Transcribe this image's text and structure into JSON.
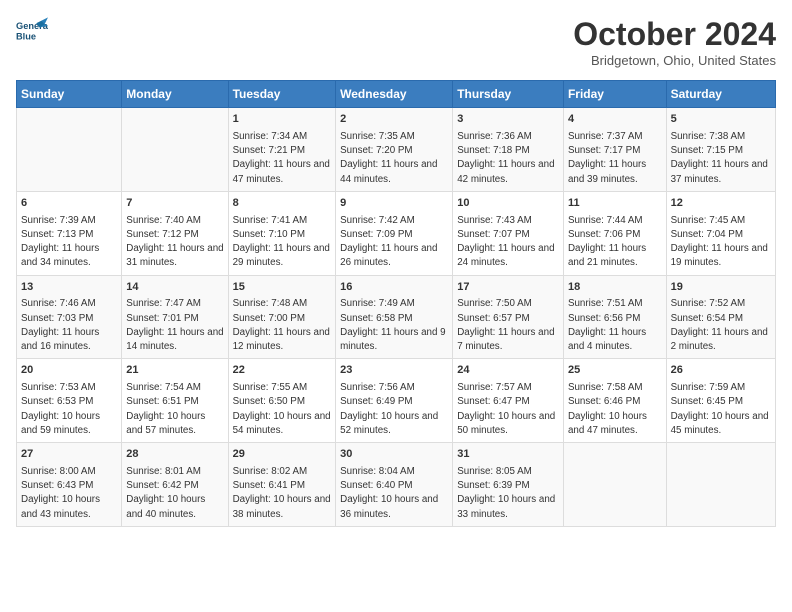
{
  "header": {
    "logo_line1": "General",
    "logo_line2": "Blue",
    "month_title": "October 2024",
    "location": "Bridgetown, Ohio, United States"
  },
  "columns": [
    "Sunday",
    "Monday",
    "Tuesday",
    "Wednesday",
    "Thursday",
    "Friday",
    "Saturday"
  ],
  "rows": [
    [
      {
        "day": "",
        "info": ""
      },
      {
        "day": "",
        "info": ""
      },
      {
        "day": "1",
        "info": "Sunrise: 7:34 AM\nSunset: 7:21 PM\nDaylight: 11 hours and 47 minutes."
      },
      {
        "day": "2",
        "info": "Sunrise: 7:35 AM\nSunset: 7:20 PM\nDaylight: 11 hours and 44 minutes."
      },
      {
        "day": "3",
        "info": "Sunrise: 7:36 AM\nSunset: 7:18 PM\nDaylight: 11 hours and 42 minutes."
      },
      {
        "day": "4",
        "info": "Sunrise: 7:37 AM\nSunset: 7:17 PM\nDaylight: 11 hours and 39 minutes."
      },
      {
        "day": "5",
        "info": "Sunrise: 7:38 AM\nSunset: 7:15 PM\nDaylight: 11 hours and 37 minutes."
      }
    ],
    [
      {
        "day": "6",
        "info": "Sunrise: 7:39 AM\nSunset: 7:13 PM\nDaylight: 11 hours and 34 minutes."
      },
      {
        "day": "7",
        "info": "Sunrise: 7:40 AM\nSunset: 7:12 PM\nDaylight: 11 hours and 31 minutes."
      },
      {
        "day": "8",
        "info": "Sunrise: 7:41 AM\nSunset: 7:10 PM\nDaylight: 11 hours and 29 minutes."
      },
      {
        "day": "9",
        "info": "Sunrise: 7:42 AM\nSunset: 7:09 PM\nDaylight: 11 hours and 26 minutes."
      },
      {
        "day": "10",
        "info": "Sunrise: 7:43 AM\nSunset: 7:07 PM\nDaylight: 11 hours and 24 minutes."
      },
      {
        "day": "11",
        "info": "Sunrise: 7:44 AM\nSunset: 7:06 PM\nDaylight: 11 hours and 21 minutes."
      },
      {
        "day": "12",
        "info": "Sunrise: 7:45 AM\nSunset: 7:04 PM\nDaylight: 11 hours and 19 minutes."
      }
    ],
    [
      {
        "day": "13",
        "info": "Sunrise: 7:46 AM\nSunset: 7:03 PM\nDaylight: 11 hours and 16 minutes."
      },
      {
        "day": "14",
        "info": "Sunrise: 7:47 AM\nSunset: 7:01 PM\nDaylight: 11 hours and 14 minutes."
      },
      {
        "day": "15",
        "info": "Sunrise: 7:48 AM\nSunset: 7:00 PM\nDaylight: 11 hours and 12 minutes."
      },
      {
        "day": "16",
        "info": "Sunrise: 7:49 AM\nSunset: 6:58 PM\nDaylight: 11 hours and 9 minutes."
      },
      {
        "day": "17",
        "info": "Sunrise: 7:50 AM\nSunset: 6:57 PM\nDaylight: 11 hours and 7 minutes."
      },
      {
        "day": "18",
        "info": "Sunrise: 7:51 AM\nSunset: 6:56 PM\nDaylight: 11 hours and 4 minutes."
      },
      {
        "day": "19",
        "info": "Sunrise: 7:52 AM\nSunset: 6:54 PM\nDaylight: 11 hours and 2 minutes."
      }
    ],
    [
      {
        "day": "20",
        "info": "Sunrise: 7:53 AM\nSunset: 6:53 PM\nDaylight: 10 hours and 59 minutes."
      },
      {
        "day": "21",
        "info": "Sunrise: 7:54 AM\nSunset: 6:51 PM\nDaylight: 10 hours and 57 minutes."
      },
      {
        "day": "22",
        "info": "Sunrise: 7:55 AM\nSunset: 6:50 PM\nDaylight: 10 hours and 54 minutes."
      },
      {
        "day": "23",
        "info": "Sunrise: 7:56 AM\nSunset: 6:49 PM\nDaylight: 10 hours and 52 minutes."
      },
      {
        "day": "24",
        "info": "Sunrise: 7:57 AM\nSunset: 6:47 PM\nDaylight: 10 hours and 50 minutes."
      },
      {
        "day": "25",
        "info": "Sunrise: 7:58 AM\nSunset: 6:46 PM\nDaylight: 10 hours and 47 minutes."
      },
      {
        "day": "26",
        "info": "Sunrise: 7:59 AM\nSunset: 6:45 PM\nDaylight: 10 hours and 45 minutes."
      }
    ],
    [
      {
        "day": "27",
        "info": "Sunrise: 8:00 AM\nSunset: 6:43 PM\nDaylight: 10 hours and 43 minutes."
      },
      {
        "day": "28",
        "info": "Sunrise: 8:01 AM\nSunset: 6:42 PM\nDaylight: 10 hours and 40 minutes."
      },
      {
        "day": "29",
        "info": "Sunrise: 8:02 AM\nSunset: 6:41 PM\nDaylight: 10 hours and 38 minutes."
      },
      {
        "day": "30",
        "info": "Sunrise: 8:04 AM\nSunset: 6:40 PM\nDaylight: 10 hours and 36 minutes."
      },
      {
        "day": "31",
        "info": "Sunrise: 8:05 AM\nSunset: 6:39 PM\nDaylight: 10 hours and 33 minutes."
      },
      {
        "day": "",
        "info": ""
      },
      {
        "day": "",
        "info": ""
      }
    ]
  ]
}
